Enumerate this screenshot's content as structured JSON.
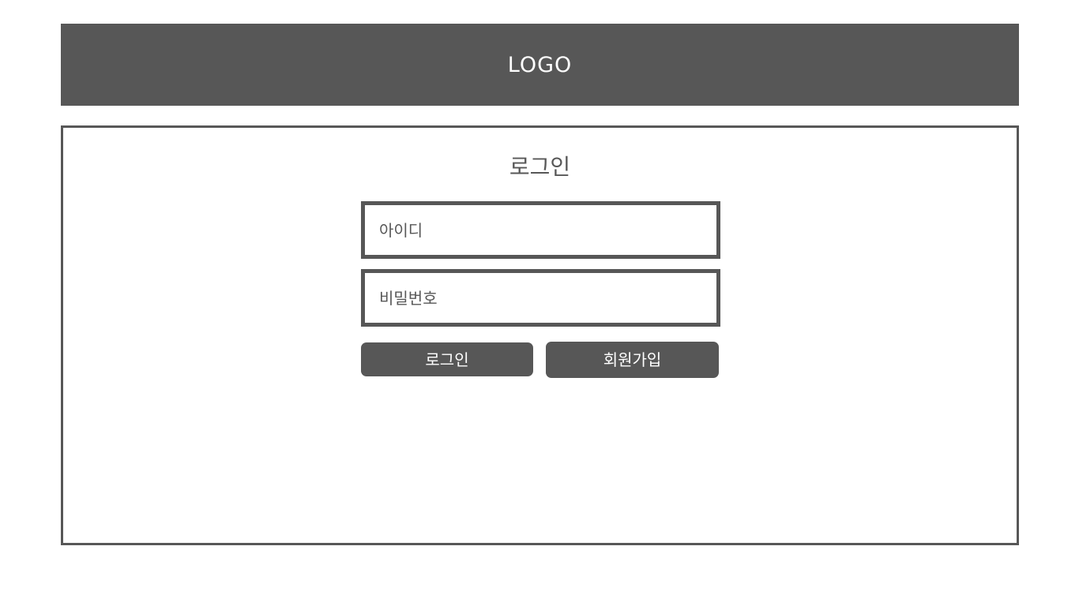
{
  "header": {
    "logo": "LOGO"
  },
  "login": {
    "title": "로그인",
    "id_field": {
      "placeholder": "아이디",
      "value": ""
    },
    "password_field": {
      "placeholder": "비밀번호",
      "value": ""
    },
    "login_button": "로그인",
    "signup_button": "회원가입"
  },
  "colors": {
    "primary": "#575757",
    "background": "#ffffff",
    "button_text": "#ffffff"
  }
}
